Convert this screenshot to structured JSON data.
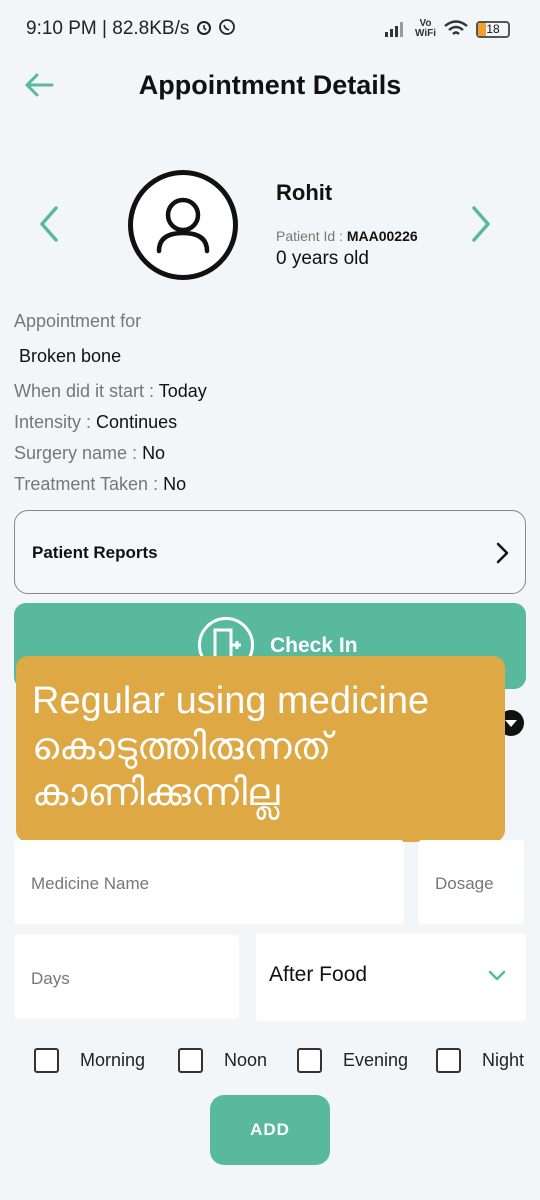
{
  "status_bar": {
    "time": "9:10 PM | 82.8KB/s",
    "vowifi_top": "Vo",
    "vowifi_bottom": "WiFi",
    "battery": "18"
  },
  "app_bar": {
    "title": "Appointment Details",
    "back_icon": "arrow-left-icon"
  },
  "patient": {
    "name": "Rohit",
    "id_label": "Patient Id : ",
    "id_value": "MAA00226",
    "age": "0 years old"
  },
  "appointment": {
    "for_label": "Appointment for",
    "for_value": "Broken bone",
    "start_label": "When did it start : ",
    "start_value": "Today",
    "intensity_label": "Intensity : ",
    "intensity_value": "Continues",
    "surgery_label": "Surgery name : ",
    "surgery_value": "No",
    "treatment_label": "Treatment Taken : ",
    "treatment_value": "No"
  },
  "reports": {
    "label": "Patient Reports"
  },
  "checkin": {
    "label": "Check In"
  },
  "overlay": {
    "line1": "Regular using medicine",
    "line2": "കൊടുത്തിരുന്നത്",
    "line3": "കാണിക്കുന്നില്ല"
  },
  "form": {
    "medicine_placeholder": "Medicine Name",
    "dosage_placeholder": "Dosage",
    "days_placeholder": "Days",
    "food_value": "After Food",
    "timings": [
      "Morning",
      "Noon",
      "Evening",
      "Night"
    ],
    "add_label": "ADD"
  },
  "colors": {
    "accent": "#58b99d",
    "overlay": "#dea844",
    "background": "#f3f6f8"
  }
}
